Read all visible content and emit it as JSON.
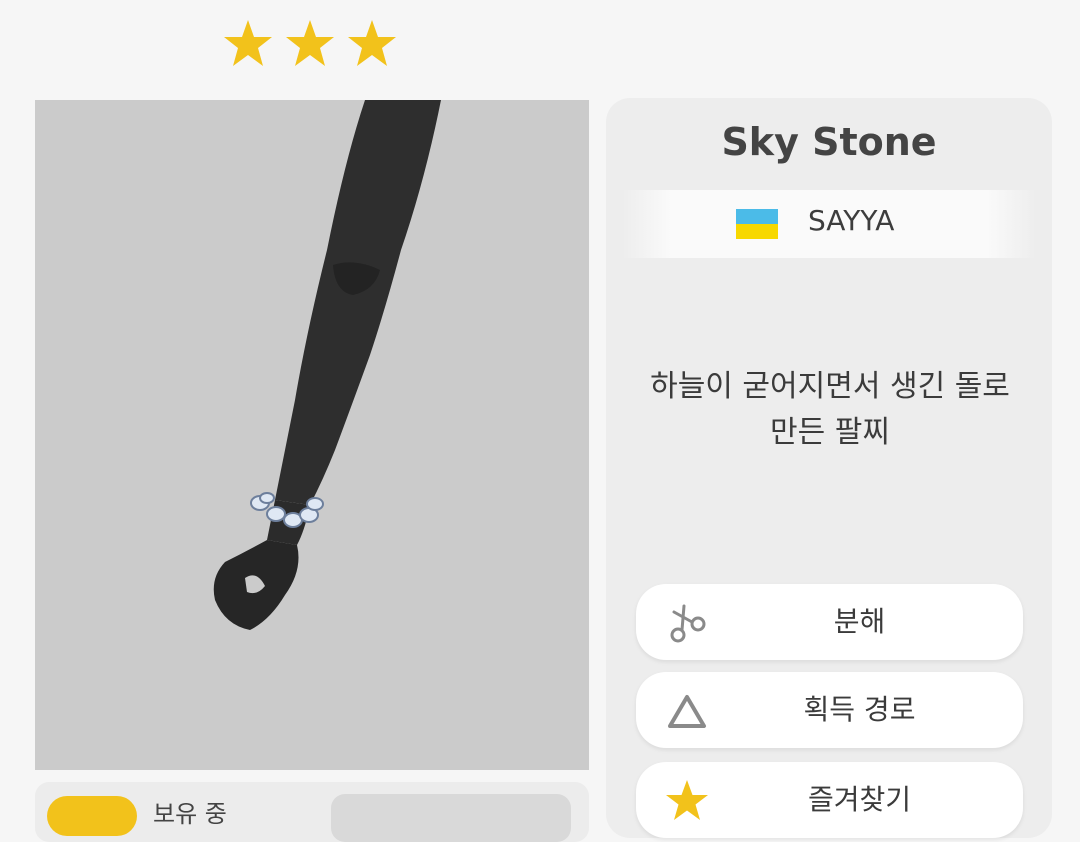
{
  "rating": {
    "stars": 3
  },
  "item": {
    "name": "Sky Stone",
    "creator": "SAYYA",
    "creator_flag": "ukraine-flag",
    "description_line1": "하늘이 굳어지면서 생긴 돌로",
    "description_line2": "만든 팔찌"
  },
  "actions": [
    {
      "label": "분해",
      "icon": "scissors-icon"
    },
    {
      "label": "획득 경로",
      "icon": "triangle-icon"
    },
    {
      "label": "즐겨찾기",
      "icon": "star-icon"
    }
  ],
  "inventory": {
    "owned_label": "보유 중"
  },
  "colors": {
    "star": "#f2c21b",
    "flag_blue": "#4bbbe8",
    "flag_yellow": "#f7d800",
    "preview_bg": "#cbcbcb"
  }
}
